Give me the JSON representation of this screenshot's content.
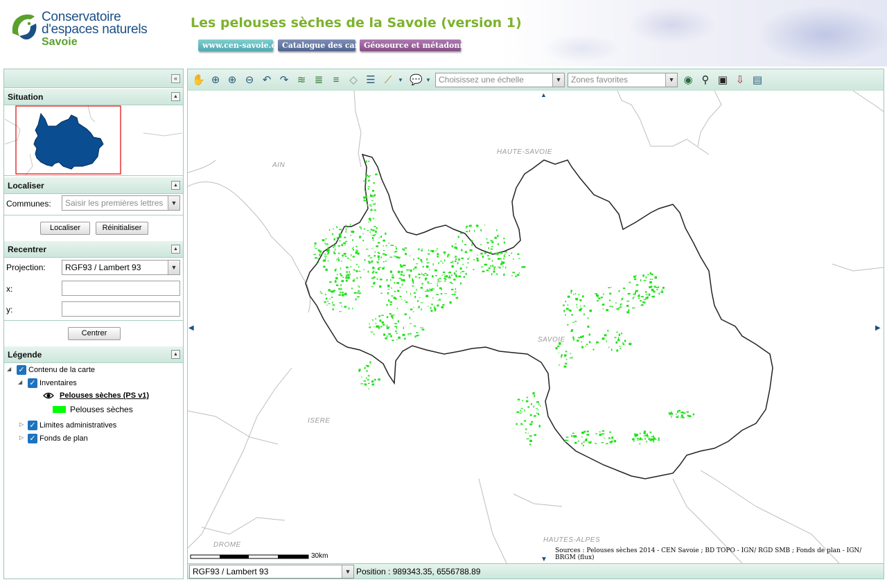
{
  "header": {
    "logo_line1": "Conservatoire",
    "logo_line2": "d'espaces naturels",
    "logo_line3": "Savoie",
    "title": "Les pelouses sèches de la Savoie (version 1)",
    "links": [
      {
        "label": "www.cen-savoie.org",
        "color": "#4fa9b0"
      },
      {
        "label": "Catalogue des cartes",
        "color": "#51648f"
      },
      {
        "label": "Géosource et métadonnées",
        "color": "#854f86"
      }
    ]
  },
  "left_panel": {
    "situation": {
      "title": "Situation"
    },
    "localiser": {
      "title": "Localiser",
      "communes_label": "Communes:",
      "communes_placeholder": "Saisir les premières lettres",
      "localiser_button": "Localiser",
      "reset_button": "Réinitialiser"
    },
    "recentrer": {
      "title": "Recentrer",
      "projection_label": "Projection:",
      "projection_value": "RGF93 / Lambert 93",
      "x_label": "x:",
      "y_label": "y:",
      "x_value": "",
      "y_value": "",
      "centrer_button": "Centrer"
    },
    "legende": {
      "title": "Légende",
      "root": "Contenu de la carte",
      "inventaires": "Inventaires",
      "layer_name": "Pelouses sèches (PS v1)",
      "layer_class": "Pelouses sèches",
      "layer_color": "#00ff00",
      "limites": "Limites administratives",
      "fonds": "Fonds de plan"
    }
  },
  "toolbar": {
    "scale_placeholder": "Choisissez une échelle",
    "zones_placeholder": "Zones favorites",
    "tools": [
      "pan-icon",
      "zoom-extent-icon",
      "zoom-in-icon",
      "zoom-out-icon",
      "previous-view-icon",
      "next-view-icon",
      "layers-icon",
      "add-layer-icon",
      "add-wfs-icon",
      "wms-icon",
      "list-icon",
      "measure-icon",
      "comment-icon",
      "globe-icon",
      "binoculars-icon",
      "save-icon",
      "export-icon",
      "print-icon"
    ]
  },
  "map": {
    "labels": {
      "ain": "AIN",
      "haute_savoie": "HAUTE-SAVOIE",
      "savoie": "SAVOIE",
      "isere": "ISERE",
      "drome": "DROME",
      "hautes_alpes": "HAUTES-ALPES"
    },
    "scale_label": "30km",
    "sources": "Sources : Pelouses sèches 2014 - CEN Savoie ; BD TOPO - IGN/ RGD SMB ; Fonds de plan - IGN/ BRGM (flux)",
    "patch_color": "#22e01a"
  },
  "status": {
    "projection": "RGF93 / Lambert 93",
    "position": "Position : 989343.35, 6556788.89"
  }
}
